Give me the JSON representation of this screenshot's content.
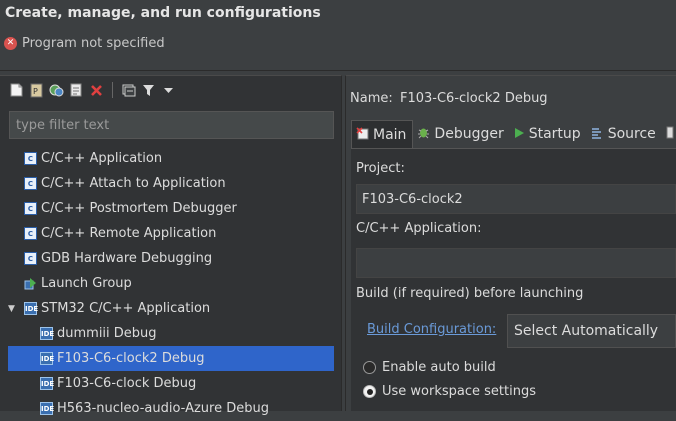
{
  "header": {
    "title": "Create, manage, and run configurations",
    "error": "Program not specified"
  },
  "toolbar": {
    "icons": [
      "new-config-icon",
      "new-proto-icon",
      "duplicate-icon",
      "export-icon",
      "delete-icon",
      "collapse-all-icon",
      "filter-icon",
      "view-menu-icon"
    ]
  },
  "filter": {
    "placeholder": "type filter text"
  },
  "tree": {
    "items": [
      {
        "label": "C/C++ Application"
      },
      {
        "label": "C/C++ Attach to Application"
      },
      {
        "label": "C/C++ Postmortem Debugger"
      },
      {
        "label": "C/C++ Remote Application"
      },
      {
        "label": "GDB Hardware Debugging"
      },
      {
        "label": "Launch Group"
      },
      {
        "label": "STM32 C/C++ Application",
        "expanded": true
      },
      {
        "label": "dummiii Debug"
      },
      {
        "label": "F103-C6-clock2 Debug",
        "selected": true
      },
      {
        "label": "F103-C6-clock Debug"
      },
      {
        "label": "H563-nucleo-audio-Azure Debug"
      }
    ]
  },
  "config": {
    "name_label": "Name:",
    "name_value": "F103-C6-clock2 Debug"
  },
  "tabs": [
    {
      "label": "Main",
      "active": true
    },
    {
      "label": "Debugger"
    },
    {
      "label": "Startup"
    },
    {
      "label": "Source"
    }
  ],
  "main": {
    "project_label": "Project:",
    "project_value": "F103-C6-clock2",
    "application_label": "C/C++ Application:",
    "application_value": "",
    "build_heading": "Build (if required) before launching",
    "build_config_link": "Build Configuration:",
    "build_config_value": "Select Automatically",
    "radio_auto_build": "Enable auto build",
    "radio_workspace": "Use workspace settings"
  },
  "colors": {
    "selection": "#2f65ca",
    "error": "#d9534f",
    "link": "#6a9ad8"
  }
}
